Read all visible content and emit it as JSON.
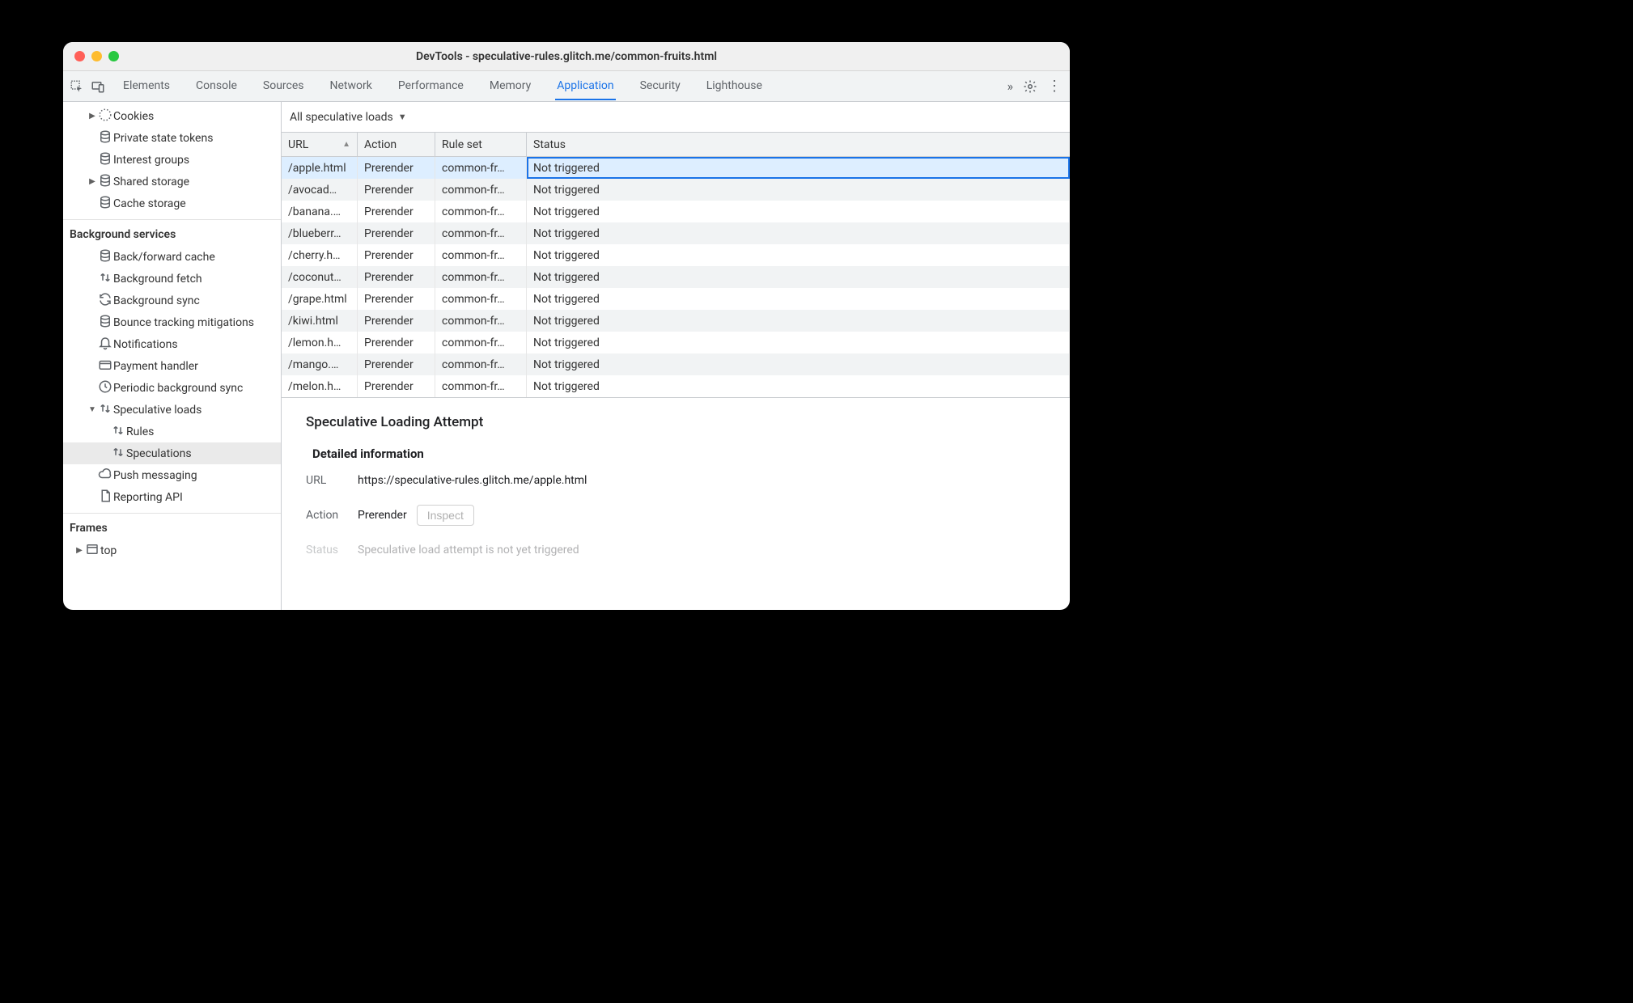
{
  "window_title": "DevTools - speculative-rules.glitch.me/common-fruits.html",
  "tabs": [
    "Elements",
    "Console",
    "Sources",
    "Network",
    "Performance",
    "Memory",
    "Application",
    "Security",
    "Lighthouse"
  ],
  "active_tab_index": 6,
  "sidebar": {
    "storage_items": [
      {
        "label": "Cookies",
        "icon": "cookie",
        "arrow": true
      },
      {
        "label": "Private state tokens",
        "icon": "db"
      },
      {
        "label": "Interest groups",
        "icon": "db"
      },
      {
        "label": "Shared storage",
        "icon": "db",
        "arrow": true
      },
      {
        "label": "Cache storage",
        "icon": "db"
      }
    ],
    "section2_title": "Background services",
    "bg_items": [
      {
        "label": "Back/forward cache",
        "icon": "db"
      },
      {
        "label": "Background fetch",
        "icon": "updown"
      },
      {
        "label": "Background sync",
        "icon": "sync"
      },
      {
        "label": "Bounce tracking mitigations",
        "icon": "db"
      },
      {
        "label": "Notifications",
        "icon": "bell"
      },
      {
        "label": "Payment handler",
        "icon": "card"
      },
      {
        "label": "Periodic background sync",
        "icon": "clock"
      },
      {
        "label": "Speculative loads",
        "icon": "updown",
        "arrow": true,
        "expanded": true
      },
      {
        "label": "Rules",
        "icon": "updown",
        "indent": 1
      },
      {
        "label": "Speculations",
        "icon": "updown",
        "indent": 1,
        "selected": true
      },
      {
        "label": "Push messaging",
        "icon": "cloud"
      },
      {
        "label": "Reporting API",
        "icon": "page"
      }
    ],
    "section3_title": "Frames",
    "frames": [
      {
        "label": "top",
        "icon": "frame",
        "arrow": true
      }
    ]
  },
  "filter_label": "All speculative loads",
  "columns": [
    "URL",
    "Action",
    "Rule set",
    "Status"
  ],
  "rows": [
    {
      "url": "/apple.html",
      "action": "Prerender",
      "ruleset": "common-fr…",
      "status": "Not triggered",
      "selected": true
    },
    {
      "url": "/avocad…",
      "action": "Prerender",
      "ruleset": "common-fr…",
      "status": "Not triggered"
    },
    {
      "url": "/banana.…",
      "action": "Prerender",
      "ruleset": "common-fr…",
      "status": "Not triggered"
    },
    {
      "url": "/blueberr…",
      "action": "Prerender",
      "ruleset": "common-fr…",
      "status": "Not triggered"
    },
    {
      "url": "/cherry.h…",
      "action": "Prerender",
      "ruleset": "common-fr…",
      "status": "Not triggered"
    },
    {
      "url": "/coconut…",
      "action": "Prerender",
      "ruleset": "common-fr…",
      "status": "Not triggered"
    },
    {
      "url": "/grape.html",
      "action": "Prerender",
      "ruleset": "common-fr…",
      "status": "Not triggered"
    },
    {
      "url": "/kiwi.html",
      "action": "Prerender",
      "ruleset": "common-fr…",
      "status": "Not triggered"
    },
    {
      "url": "/lemon.h…",
      "action": "Prerender",
      "ruleset": "common-fr…",
      "status": "Not triggered"
    },
    {
      "url": "/mango.…",
      "action": "Prerender",
      "ruleset": "common-fr…",
      "status": "Not triggered"
    },
    {
      "url": "/melon.h…",
      "action": "Prerender",
      "ruleset": "common-fr…",
      "status": "Not triggered"
    }
  ],
  "detail": {
    "heading": "Speculative Loading Attempt",
    "subheading": "Detailed information",
    "url_label": "URL",
    "url_value": "https://speculative-rules.glitch.me/apple.html",
    "action_label": "Action",
    "action_value": "Prerender",
    "inspect_label": "Inspect",
    "status_label": "Status",
    "status_value": "Speculative load attempt is not yet triggered"
  }
}
